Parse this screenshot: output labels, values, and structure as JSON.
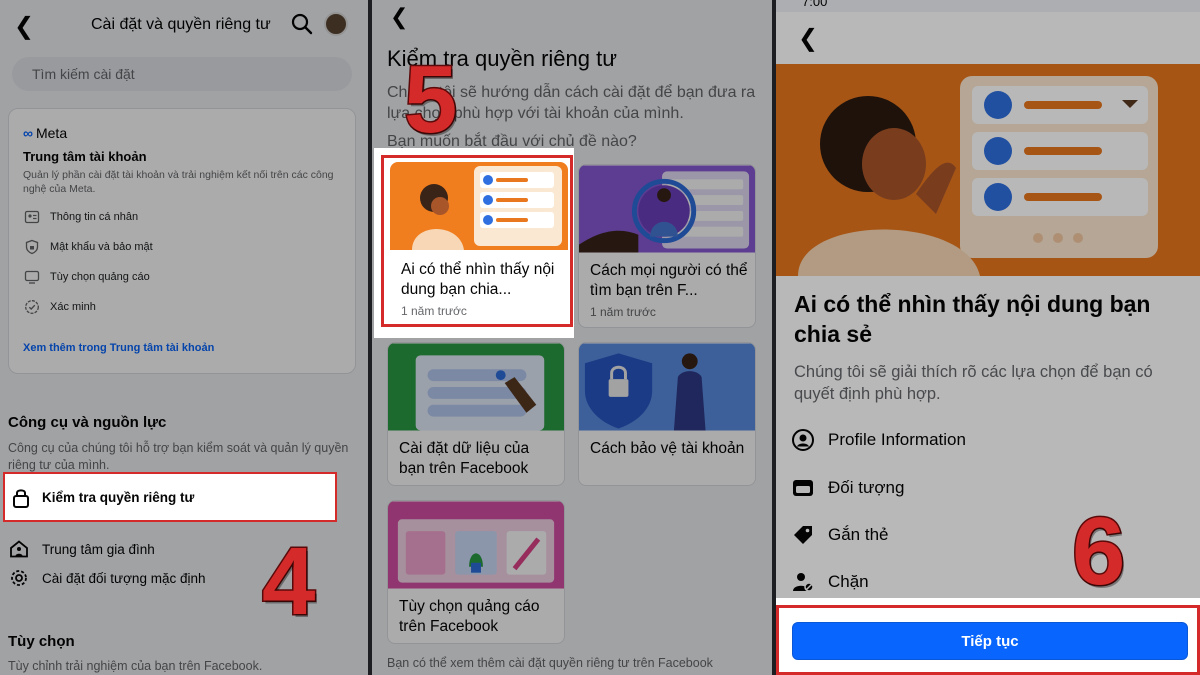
{
  "panel1": {
    "title": "Cài đặt và quyền riêng tư",
    "search_placeholder": "Tìm kiếm cài đặt",
    "accounts_center": {
      "logo": "Meta",
      "title": "Trung tâm tài khoản",
      "description": "Quản lý phần cài đặt tài khoản và trải nghiệm kết nối trên các công nghệ của Meta.",
      "items": [
        {
          "label": "Thông tin cá nhân",
          "icon": "id-card-icon"
        },
        {
          "label": "Mật khẩu và bảo mật",
          "icon": "shield-icon"
        },
        {
          "label": "Tùy chọn quảng cáo",
          "icon": "monitor-icon"
        },
        {
          "label": "Xác minh",
          "icon": "verified-badge-icon"
        }
      ],
      "link": "Xem thêm trong Trung tâm tài khoản"
    },
    "tools": {
      "title": "Công cụ và nguồn lực",
      "description": "Công cụ của chúng tôi hỗ trợ bạn kiểm soát và quản lý quyền riêng tư của mình.",
      "items": [
        {
          "label": "Kiểm tra quyền riêng tư",
          "icon": "lock-icon"
        },
        {
          "label": "Trung tâm gia đình",
          "icon": "family-icon"
        },
        {
          "label": "Cài đặt đối tượng mặc định",
          "icon": "gear-icon"
        }
      ]
    },
    "options": {
      "title": "Tùy chọn",
      "description": "Tùy chỉnh trải nghiệm của bạn trên Facebook."
    },
    "step_number": "4"
  },
  "panel2": {
    "title": "Kiểm tra quyền riêng tư",
    "description": "Chúng tôi sẽ hướng dẫn cách cài đặt để bạn đưa ra lựa chọn phù hợp với tài khoản của mình.",
    "question": "Bạn muốn bắt đầu với chủ đề nào?",
    "topics": [
      {
        "title": "Ai có thể nhìn thấy nội dung bạn chia...",
        "subtitle": "1 năm trước"
      },
      {
        "title": "Cách mọi người có thể tìm bạn trên F...",
        "subtitle": "1 năm trước"
      },
      {
        "title": "Cài đặt dữ liệu của bạn trên Facebook",
        "subtitle": ""
      },
      {
        "title": "Cách bảo vệ tài khoản",
        "subtitle": ""
      },
      {
        "title": "Tùy chọn quảng cáo trên Facebook",
        "subtitle": ""
      }
    ],
    "footer": "Bạn có thể xem thêm cài đặt quyền riêng tư trên Facebook",
    "step_number": "5"
  },
  "panel3": {
    "status_time": "7:00",
    "heading": "Ai có thể nhìn thấy nội dung bạn chia sẻ",
    "lead": "Chúng tôi sẽ giải thích rõ các lựa chọn để bạn có quyết định phù hợp.",
    "items": [
      {
        "label": "Profile Information",
        "icon": "profile-icon"
      },
      {
        "label": "Đối tượng",
        "icon": "audience-icon"
      },
      {
        "label": "Gắn thẻ",
        "icon": "tag-icon"
      },
      {
        "label": "Chặn",
        "icon": "block-user-icon"
      }
    ],
    "button": "Tiếp tục",
    "step_number": "6"
  },
  "colors": {
    "facebook_blue": "#0866ff",
    "highlight_red": "#d42a2a",
    "hero_orange": "#e8771e"
  }
}
